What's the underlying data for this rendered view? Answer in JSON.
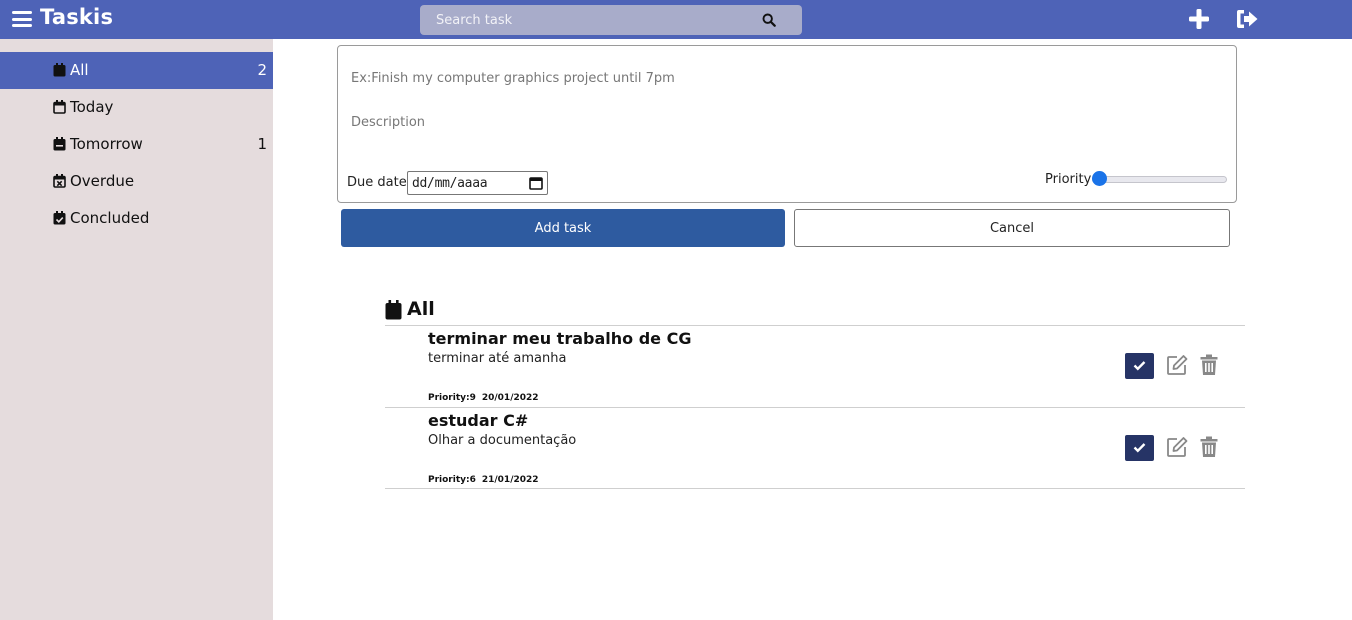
{
  "header": {
    "app_title": "Taskis",
    "search_placeholder": "Search task",
    "icons": [
      "menu-icon",
      "search-icon",
      "plus-icon",
      "logout-icon"
    ]
  },
  "sidebar": {
    "items": [
      {
        "label": "All",
        "count": "2",
        "icon": "calendar-icon",
        "active": true
      },
      {
        "label": "Today",
        "count": "",
        "icon": "calendar-outline-icon",
        "active": false
      },
      {
        "label": "Tomorrow",
        "count": "1",
        "icon": "calendar-minus-icon",
        "active": false
      },
      {
        "label": "Overdue",
        "count": "",
        "icon": "calendar-x-icon",
        "active": false
      },
      {
        "label": "Concluded",
        "count": "",
        "icon": "calendar-check-icon",
        "active": false
      }
    ]
  },
  "form": {
    "title_placeholder": "Ex:Finish my computer graphics project until 7pm",
    "description_placeholder": "Description",
    "due_label": "Due date",
    "due_value": "dd/mm/aaaa",
    "priority_label": "Priority",
    "priority_value": 0,
    "add_label": "Add task",
    "cancel_label": "Cancel"
  },
  "list": {
    "title": "All",
    "tasks": [
      {
        "title": "terminar meu trabalho de CG",
        "description": "terminar até amanha",
        "priority": "Priority:9",
        "date": "20/01/2022"
      },
      {
        "title": "estudar C#",
        "description": "Olhar a documentação",
        "priority": "Priority:6",
        "date": "21/01/2022"
      }
    ]
  },
  "colors": {
    "topbar": "#4e63b7",
    "sidebar_bg": "#e5dcdd",
    "active_item": "#4e63b7",
    "add_button": "#2e5ba0",
    "check_button": "#263466"
  }
}
